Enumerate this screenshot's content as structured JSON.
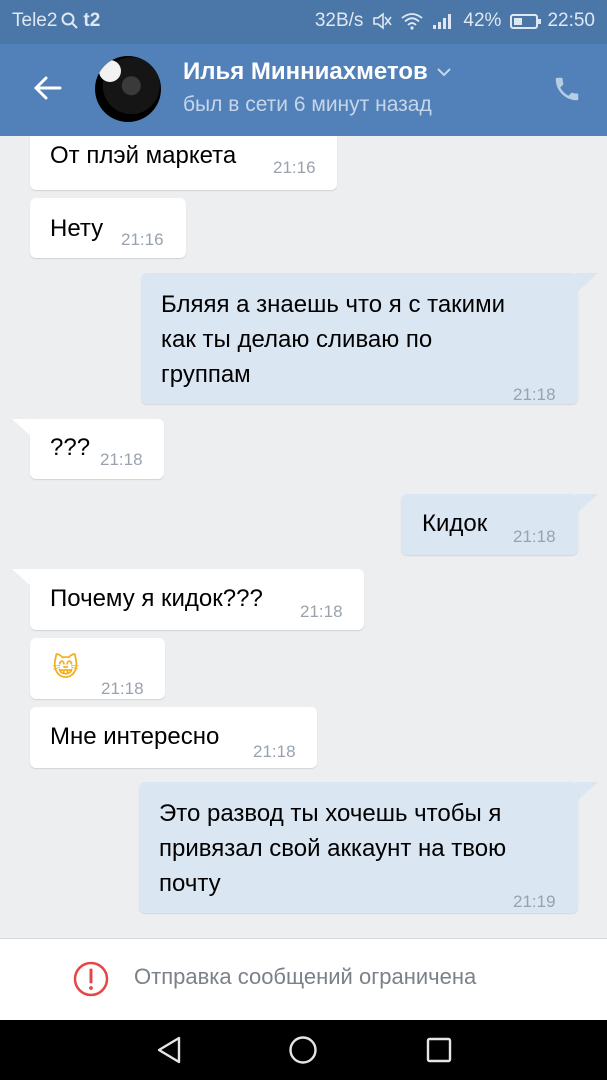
{
  "status_bar": {
    "carrier": "Tele2",
    "carrier_extra": "t2",
    "speed": "32B/s",
    "battery": "42%",
    "battery_level": 0.42,
    "time": "22:50"
  },
  "header": {
    "contact_name": "Илья Минниахметов",
    "contact_status": "был в сети 6 минут назад"
  },
  "messages": [
    {
      "direction": "in",
      "text": "От плэй маркета",
      "time": "21:16"
    },
    {
      "direction": "in",
      "text": "Нету",
      "time": "21:16"
    },
    {
      "direction": "out",
      "lines": [
        "Бляяя а знаешь что я с  такими",
        "как ты делаю сливаю по",
        "группам"
      ],
      "time": "21:18"
    },
    {
      "direction": "in",
      "text": "???",
      "time": "21:18"
    },
    {
      "direction": "out",
      "text": "Кидок",
      "time": "21:18"
    },
    {
      "direction": "in",
      "text": "Почему я кидок???",
      "time": "21:18"
    },
    {
      "direction": "in",
      "text": "😸",
      "time": "21:18"
    },
    {
      "direction": "in",
      "text": "Мне интересно",
      "time": "21:18"
    },
    {
      "direction": "out",
      "lines": [
        "Это развод ты хочешь чтобы я",
        "привязал свой аккаунт на твою",
        "почту"
      ],
      "time": "21:19"
    }
  ],
  "footer": {
    "restricted_text": "Отправка сообщений ограничена"
  },
  "colors": {
    "header": "#5181b8",
    "status_bar": "#4a76a8",
    "background": "#edeef0",
    "outgoing_bubble": "#dbe6f3",
    "incoming_bubble": "#ffffff",
    "warning": "#e64646"
  },
  "icons": {
    "back": "arrow-left-icon",
    "phone": "phone-icon",
    "dropdown": "chevron-down-icon",
    "warning": "exclamation-circle-icon"
  }
}
